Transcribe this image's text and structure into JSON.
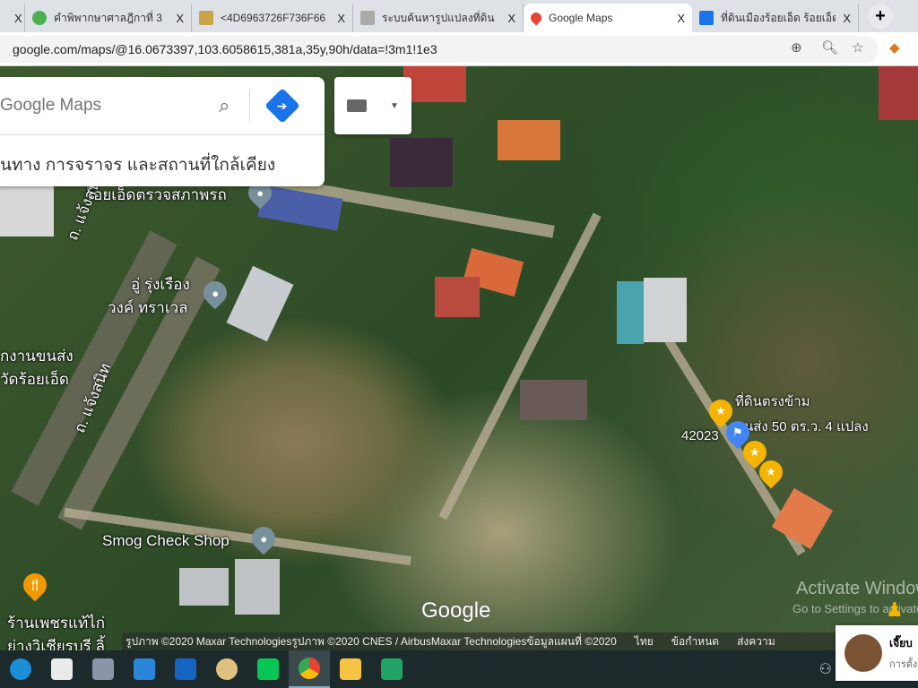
{
  "browser": {
    "tabs": [
      {
        "title": "คำพิพากษาศาลฎีกาที่ 3",
        "icon": "green-circle-icon",
        "color": "#4caf50"
      },
      {
        "title": "<4D6963726F736F66",
        "icon": "image-icon",
        "color": "#c9a54a"
      },
      {
        "title": "ระบบค้นหารูปแปลงที่ดิน",
        "icon": "books-icon",
        "color": "#999"
      },
      {
        "title": "Google Maps",
        "icon": "maps-pin-icon",
        "color": "#ea4335",
        "active": true
      },
      {
        "title": "ที่ดินเมืองร้อยเอ็ด ร้อยเอ็ด",
        "icon": "house-icon",
        "color": "#1a73e8"
      }
    ],
    "close_glyph": "X",
    "new_tab": "+",
    "url": "google.com/maps/@16.0673397,103.6058615,381a,35y,90h/data=!3m1!1e3"
  },
  "maps": {
    "search_placeholder": "Google Maps",
    "suggestion": "นทาง การจราจร และสถานที่ใกล้เคียง",
    "labels": {
      "top": "ร้อยเอ็ดตรวจสภาพรถ",
      "road1": "ถ. แจ้งสนิท",
      "road2": "ถ. แจ้งสนิท",
      "rung1": "อู่ รุ่งเรือง",
      "rung2": "วงค์ ทราเวล",
      "trans1": "กงานขนส่ง",
      "trans2": "วัดร้อยเอ็ด",
      "land1": "ที่ดินตรงข้าม",
      "land2": "นส่ง 50 ตร.ว. 4 แปลง",
      "num": "42023",
      "smog": "Smog Check Shop",
      "rest1": "ร้านเพชรแท้ไก่",
      "rest2": "ย่างวิเชียรบุรี ลิ้",
      "logo": "Google",
      "activate1": "Activate Windows",
      "activate2": "Go to Settings to activate Windows."
    },
    "footer": {
      "credits": "รูปภาพ ©2020 Maxar Technologiesรูปภาพ ©2020 CNES / AirbusMaxar Technologiesข้อมูลแผนที่ ©2020",
      "lang": "ไทย",
      "terms": "ข้อกำหนด",
      "feedback": "ส่งความ"
    }
  },
  "notification": {
    "title": "เจี๊ยบ",
    "subtitle": "การตั้ง"
  },
  "taskbar": {
    "icons": [
      "edge-icon",
      "store-icon",
      "calculator-icon",
      "mail-icon",
      "bluemail-icon",
      "paint-icon",
      "line-icon",
      "chrome-icon",
      "file-explorer-icon",
      "green-app-icon"
    ]
  }
}
